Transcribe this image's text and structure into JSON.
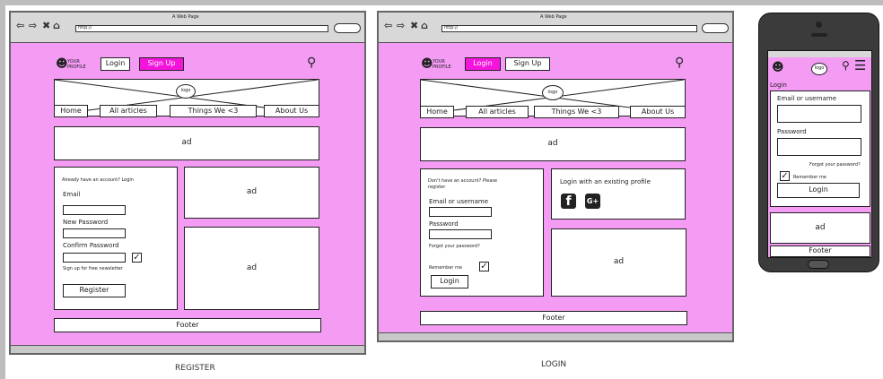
{
  "register": {
    "window_title": "A Web Page",
    "url": "http://",
    "profile_text": "YOUR PROFILE",
    "login_btn": "Login",
    "signup_btn": "Sign Up",
    "logo": "logo",
    "nav": [
      "Home",
      "All articles",
      "Things We <3",
      "About Us"
    ],
    "ad": "ad",
    "form_header": "Already have an account? Login",
    "email_label": "Email",
    "new_password_label": "New Password",
    "confirm_password_label": "Confirm Password",
    "newsletter_label": "Sign up for free newsletter",
    "register_btn": "Register",
    "footer": "Footer",
    "caption": "REGISTER"
  },
  "login": {
    "window_title": "A Web Page",
    "url": "http://",
    "profile_text": "YOUR PROFILE",
    "login_btn": "Login",
    "signup_btn": "Sign Up",
    "logo": "logo",
    "nav": [
      "Home",
      "All articles",
      "Things We <3",
      "About Us"
    ],
    "ad": "ad",
    "form_header": "Don't have an account? Please register",
    "email_label": "Email or username",
    "password_label": "Password",
    "forgot": "Forgot your password?",
    "remember": "Remember me",
    "login_submit": "Login",
    "existing_profile": "Login with an existing profile",
    "google_label": "G+",
    "footer": "Footer",
    "caption": "LOGIN"
  },
  "mobile": {
    "logo": "logo",
    "login_heading": "Login",
    "email_label": "Email or username",
    "password_label": "Password",
    "forgot": "Forgot your password?",
    "remember": "Remember me",
    "login_btn": "Login",
    "ad": "ad",
    "footer": "Footer"
  },
  "colors": {
    "pink_bg": "#f49cf4",
    "magenta": "#f414dc"
  }
}
